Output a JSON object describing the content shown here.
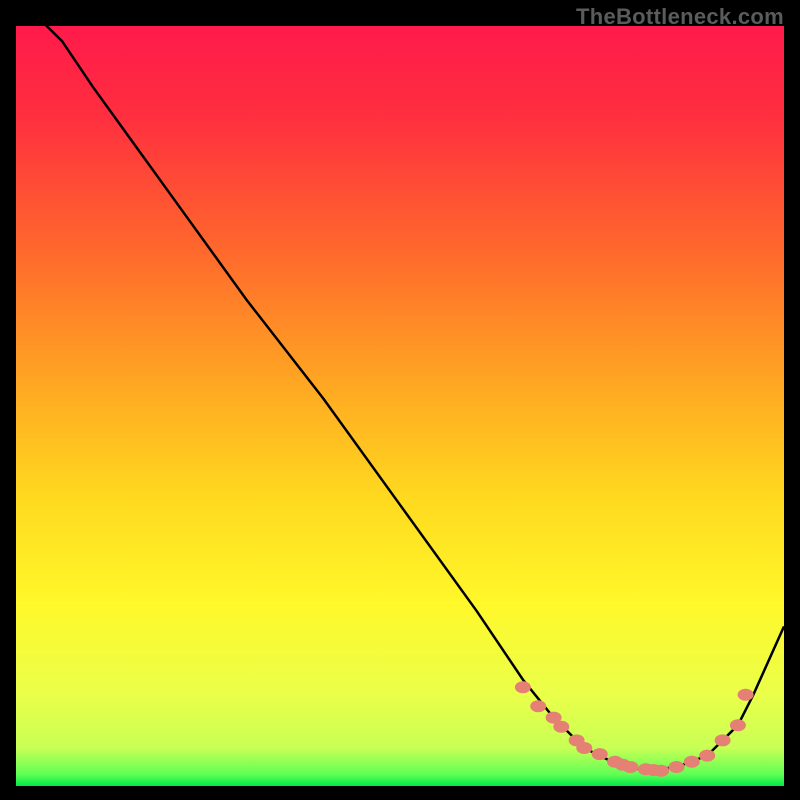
{
  "watermark": "TheBottleneck.com",
  "chart_data": {
    "type": "line",
    "title": "",
    "xlabel": "",
    "ylabel": "",
    "xlim": [
      0,
      100
    ],
    "ylim": [
      0,
      100
    ],
    "grid": false,
    "legend": false,
    "series": [
      {
        "name": "curve",
        "color": "#000000",
        "x": [
          0,
          4,
          6,
          10,
          20,
          30,
          40,
          50,
          60,
          66,
          70,
          74,
          78,
          82,
          86,
          90,
          94,
          96,
          100
        ],
        "y": [
          104,
          100,
          98,
          92,
          78,
          64,
          51,
          37,
          23,
          14,
          9,
          5,
          3,
          2,
          2.5,
          4,
          8,
          12,
          21
        ]
      }
    ],
    "highlight_points": {
      "name": "points",
      "color": "#e58074",
      "x": [
        66,
        68,
        70,
        71,
        73,
        74,
        76,
        78,
        79,
        80,
        82,
        83,
        84,
        86,
        88,
        90,
        92,
        94,
        95
      ],
      "y": [
        13.0,
        10.5,
        9.0,
        7.8,
        6.0,
        5.0,
        4.2,
        3.2,
        2.8,
        2.5,
        2.2,
        2.1,
        2.0,
        2.5,
        3.2,
        4.0,
        6.0,
        8.0,
        12.0
      ]
    },
    "background_gradient": {
      "stops": [
        {
          "pos": 0.0,
          "color": "#ff1a4b"
        },
        {
          "pos": 0.12,
          "color": "#ff2f3f"
        },
        {
          "pos": 0.3,
          "color": "#ff6a2c"
        },
        {
          "pos": 0.48,
          "color": "#ffaa22"
        },
        {
          "pos": 0.62,
          "color": "#ffd91f"
        },
        {
          "pos": 0.76,
          "color": "#fff82a"
        },
        {
          "pos": 0.88,
          "color": "#eaff4a"
        },
        {
          "pos": 0.95,
          "color": "#c8ff55"
        },
        {
          "pos": 0.985,
          "color": "#5fff55"
        },
        {
          "pos": 1.0,
          "color": "#00e84a"
        }
      ]
    }
  }
}
